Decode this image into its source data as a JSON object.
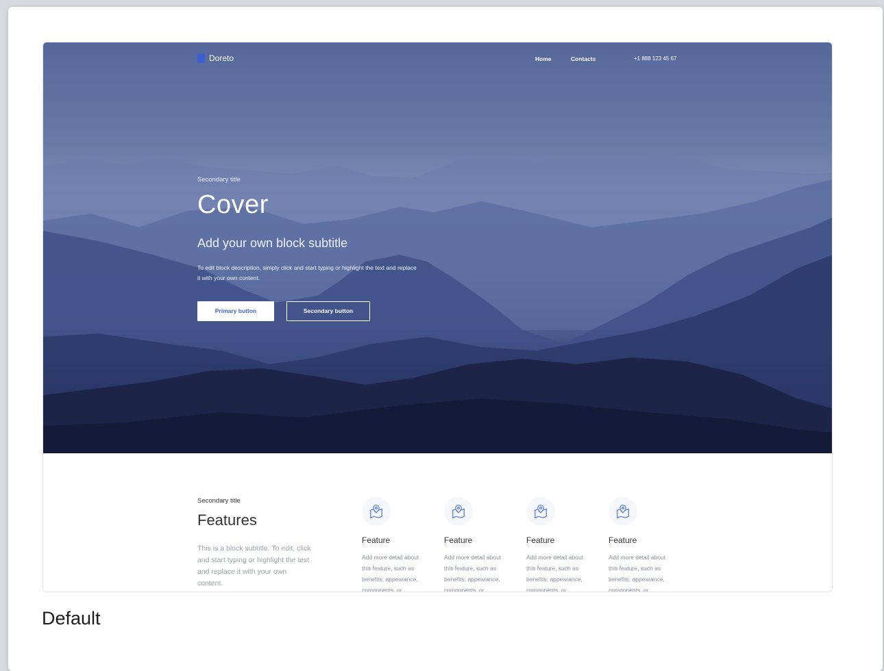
{
  "nav": {
    "logo_text": "Doreto",
    "links": [
      "Home",
      "Contacts"
    ],
    "phone": "+1 888 123 45 67"
  },
  "hero": {
    "secondary_title": "Secondary title",
    "title": "Cover",
    "subtitle": "Add your own block subtitle",
    "description": "To edit block description, simply click and start typing or highlight the text and replace it with your own content.",
    "primary_button": "Primary button",
    "secondary_button": "Secondary button"
  },
  "features": {
    "secondary_title": "Secondary title",
    "title": "Features",
    "description": "This is a block subtitle. To edit, click and start typing or highlight the text and replace it with your own content.",
    "items": [
      {
        "name": "Feature",
        "text": "Add more detail about this feature, such as benefits, appearance, components, or",
        "icon": "map-pin-icon"
      },
      {
        "name": "Feature",
        "text": "Add more detail about this feature, such as benefits, appearance, components, or",
        "icon": "map-pin-icon"
      },
      {
        "name": "Feature",
        "text": "Add more detail about this feature, such as benefits, appearance, components, or",
        "icon": "map-pin-icon"
      },
      {
        "name": "Feature",
        "text": "Add more detail about this feature, such as benefits, appearance, components, or",
        "icon": "map-pin-icon"
      }
    ]
  },
  "caption": "Default",
  "colors": {
    "accent": "#3c64cc",
    "hero_top": "#56689a",
    "hero_bottom": "#141c3c"
  }
}
